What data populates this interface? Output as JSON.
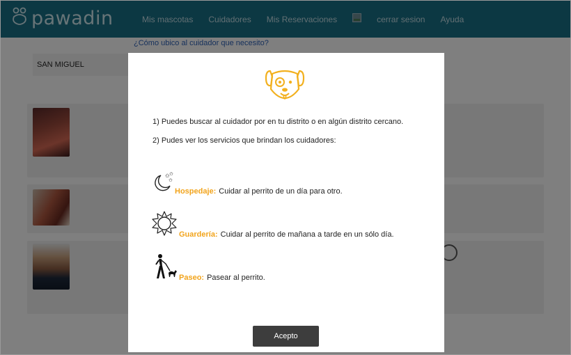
{
  "nav": {
    "logo_text": "pawadin",
    "links": [
      "Mis mascotas",
      "Cuidadores",
      "Mis Reservaciones"
    ],
    "logout": "cerrar sesion",
    "help": "Ayuda"
  },
  "page": {
    "help_link": "¿Cómo ubico al cuidador que necesito?",
    "district_value": "SAN MIGUEL"
  },
  "modal": {
    "line1": "1) Puedes buscar al cuidador por en tu distrito o en algún distrito cercano.",
    "line2": "2) Pudes ver los servicios que brindan los cuidadores:",
    "services": [
      {
        "name": "Hospedaje:",
        "desc": "Cuidar al perrito de un día para otro.",
        "icon": "moon-stars-icon"
      },
      {
        "name": "Guardería:",
        "desc": "Cuidar al perrito de mañana a tarde en un sólo día.",
        "icon": "sun-icon"
      },
      {
        "name": "Paseo:",
        "desc": "Pasear al perrito.",
        "icon": "dog-walker-icon"
      }
    ],
    "accept_label": "Acepto"
  },
  "colors": {
    "navbar": "#187087",
    "accent_orange": "#f2a41c",
    "dog_icon_yellow": "#f2b01e",
    "button_dark": "#3d3d3d"
  }
}
